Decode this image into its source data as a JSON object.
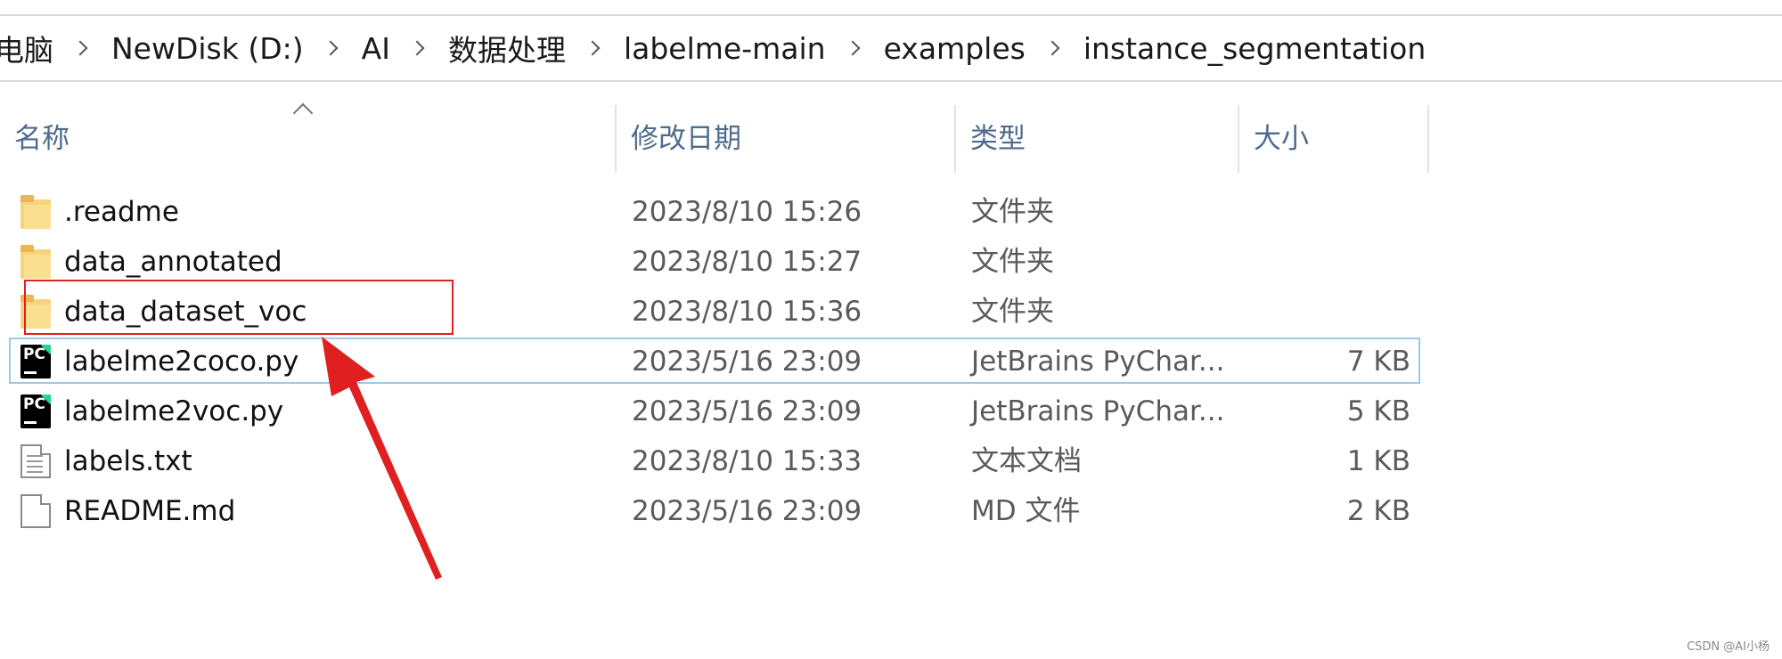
{
  "breadcrumb": {
    "items": [
      "电脑",
      "NewDisk (D:)",
      "AI",
      "数据处理",
      "labelme-main",
      "examples",
      "instance_segmentation"
    ]
  },
  "columns": {
    "name": "名称",
    "date": "修改日期",
    "type": "类型",
    "size": "大小"
  },
  "files": [
    {
      "name": ".readme",
      "date": "2023/8/10 15:26",
      "type": "文件夹",
      "size": "",
      "icon": "folder-icon"
    },
    {
      "name": "data_annotated",
      "date": "2023/8/10 15:27",
      "type": "文件夹",
      "size": "",
      "icon": "folder-icon"
    },
    {
      "name": "data_dataset_voc",
      "date": "2023/8/10 15:36",
      "type": "文件夹",
      "size": "",
      "icon": "folder-icon"
    },
    {
      "name": "labelme2coco.py",
      "date": "2023/5/16 23:09",
      "type": "JetBrains PyChar...",
      "size": "7 KB",
      "icon": "pycharm-file-icon"
    },
    {
      "name": "labelme2voc.py",
      "date": "2023/5/16 23:09",
      "type": "JetBrains PyChar...",
      "size": "5 KB",
      "icon": "pycharm-file-icon"
    },
    {
      "name": "labels.txt",
      "date": "2023/8/10 15:33",
      "type": "文本文档",
      "size": "1 KB",
      "icon": "text-file-icon"
    },
    {
      "name": "README.md",
      "date": "2023/5/16 23:09",
      "type": "MD 文件",
      "size": "2 KB",
      "icon": "md-file-icon"
    }
  ],
  "pycharm_icon_text": "PC",
  "watermark": "CSDN @AI小杨",
  "colors": {
    "annotation_red": "#e02020",
    "selection_border": "#99c9ef",
    "header_text": "#4d6b8c",
    "folder": "#f7d37b"
  }
}
